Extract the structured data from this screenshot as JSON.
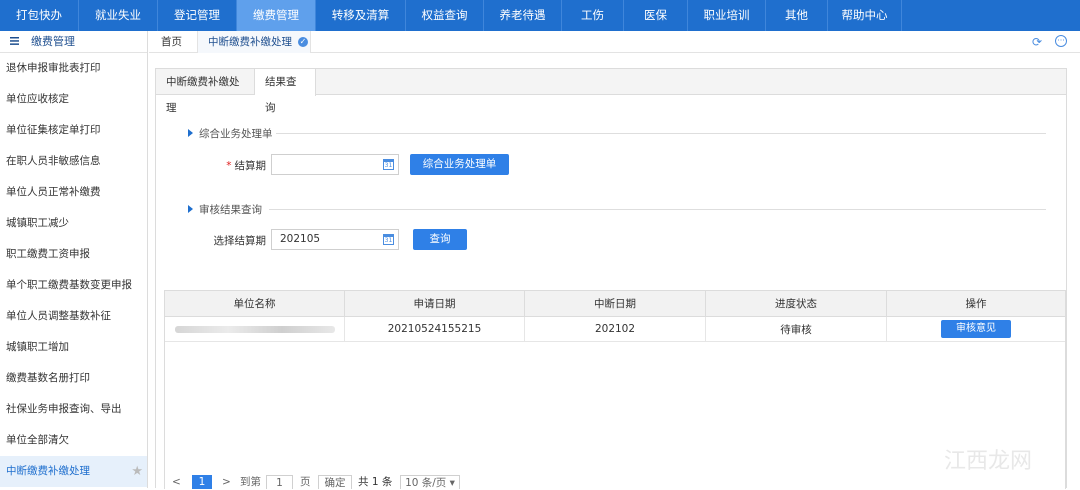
{
  "top_nav": {
    "items": [
      {
        "label": "打包快办"
      },
      {
        "label": "就业失业"
      },
      {
        "label": "登记管理"
      },
      {
        "label": "缴费管理",
        "active": true
      },
      {
        "label": "转移及清算"
      },
      {
        "label": "权益查询"
      },
      {
        "label": "养老待遇"
      },
      {
        "label": "工伤"
      },
      {
        "label": "医保"
      },
      {
        "label": "职业培训"
      },
      {
        "label": "其他"
      },
      {
        "label": "帮助中心"
      }
    ]
  },
  "sidebar": {
    "title": "缴费管理",
    "items": [
      {
        "label": "退休申报审批表打印"
      },
      {
        "label": "单位应收核定"
      },
      {
        "label": "单位征集核定单打印"
      },
      {
        "label": "在职人员非敏感信息"
      },
      {
        "label": "单位人员正常补缴费"
      },
      {
        "label": "城镇职工减少"
      },
      {
        "label": "职工缴费工资申报"
      },
      {
        "label": "单个职工缴费基数变更申报"
      },
      {
        "label": "单位人员调整基数补征"
      },
      {
        "label": "城镇职工增加"
      },
      {
        "label": "缴费基数名册打印"
      },
      {
        "label": "社保业务申报查询、导出"
      },
      {
        "label": "单位全部清欠"
      },
      {
        "label": "中断缴费补缴处理",
        "active": true
      }
    ]
  },
  "tabbar": {
    "home": "首页",
    "current": "中断缴费补缴处理"
  },
  "subtabs": {
    "tab1": "中断缴费补缴处理",
    "tab2": "结果查询"
  },
  "section1": {
    "title": "综合业务处理单",
    "label": "结算期",
    "input_value": "",
    "button": "综合业务处理单"
  },
  "section2": {
    "title": "审核结果查询",
    "label": "选择结算期",
    "input_value": "202105",
    "button": "查询"
  },
  "table": {
    "headers": [
      "单位名称",
      "申请日期",
      "中断日期",
      "进度状态",
      "操作"
    ],
    "rows": [
      {
        "name": "",
        "apply_date": "20210524155215",
        "break_date": "202102",
        "status": "待审核",
        "action": "审核意见"
      }
    ]
  },
  "pager": {
    "prev": "<",
    "current_page": "1",
    "next": ">",
    "goto": "到第",
    "page_input": "1",
    "page_unit": "页",
    "confirm": "确定",
    "total": "共 1 条",
    "page_size": "10 条/页"
  },
  "watermark": "江西龙网"
}
